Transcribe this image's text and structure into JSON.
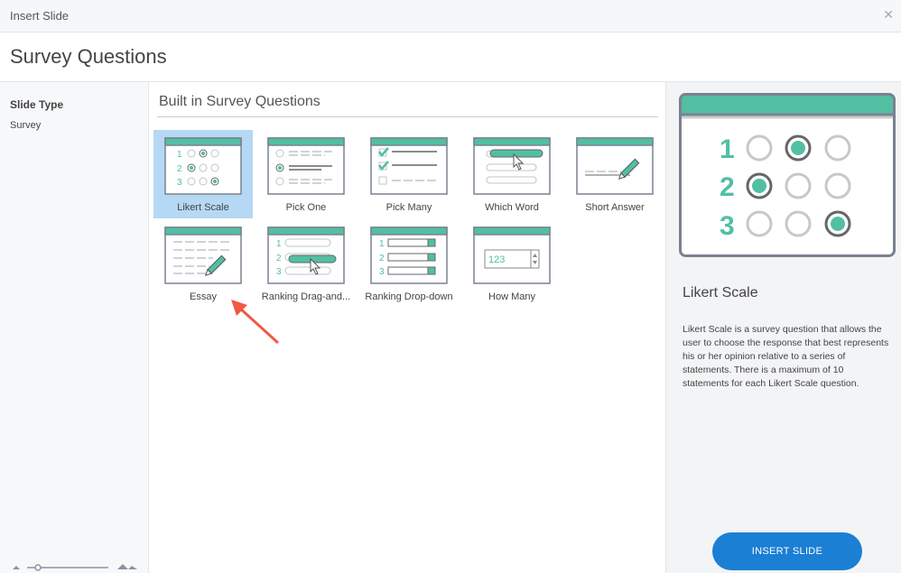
{
  "window": {
    "title": "Insert Slide",
    "close_icon": "close-icon"
  },
  "header": {
    "title": "Survey Questions"
  },
  "sidebar": {
    "label": "Slide Type",
    "value": "Survey"
  },
  "main": {
    "section_title": "Built in Survey Questions",
    "items": [
      {
        "label": "Likert Scale",
        "selected": true
      },
      {
        "label": "Pick One"
      },
      {
        "label": "Pick Many"
      },
      {
        "label": "Which Word"
      },
      {
        "label": "Short Answer"
      },
      {
        "label": "Essay"
      },
      {
        "label": "Ranking  Drag-and..."
      },
      {
        "label": "Ranking Drop-down"
      },
      {
        "label": "How Many"
      }
    ]
  },
  "preview": {
    "title": "Likert Scale",
    "description": "Likert Scale is a survey question that allows the user to choose the response that best represents his or her opinion relative to a series of statements. There is a maximum of 10 statements for each Likert Scale question.",
    "numbers": [
      "1",
      "2",
      "3"
    ],
    "how_many_value": "123"
  },
  "footer": {
    "insert_label": "INSERT SLIDE"
  },
  "colors": {
    "accent": "#52bfa3",
    "button": "#1b7fd4",
    "selection": "#b5d8f4",
    "annotation": "#ef5a45"
  }
}
